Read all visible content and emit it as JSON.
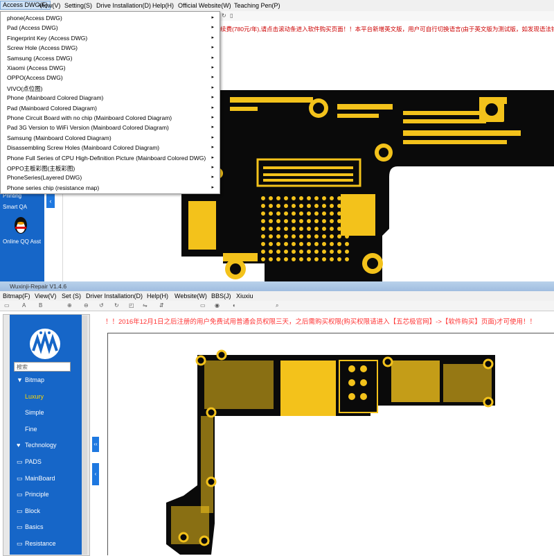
{
  "top_window": {
    "menu": [
      "Access DWG(F)",
      "View(V)",
      "Setting(S)",
      "Drive Installation(D)",
      "Help(H)",
      "Official Website(W)",
      "Teaching Pen(P)"
    ],
    "notice": "续费(780元/年),请点击滚动条进入软件购买页面！！本平台新增英文版，用户可自行切换语言(由于英文版为测试版，如发现语法错误",
    "dropdown_items": [
      "phone(Access DWG)",
      "Pad (Access DWG)",
      "Fingerprint Key (Access DWG)",
      "Screw Hole (Access DWG)",
      "Samsung (Access DWG)",
      "Xiaomi (Access DWG)",
      "OPPO(Access DWG)",
      "VIVO(点位图)",
      "Phone (Mainboard Colored Diagram)",
      "Pad (Mainboard Colored Diagram)",
      "Phone Circuit Board with no chip (Mainboard Colored Diagram)",
      "Pad 3G Version to WiFi Version (Mainboard Colored Diagram)",
      "Samsung (Mainboard Colored Diagram)",
      "Disassembling Screw Holes (Mainboard Colored Diagram)",
      "Phone Full Series of CPU High-Definition Picture (Mainboard Colored DWG)",
      "OPPO主板彩图(主板彩图)",
      "PhoneSeries(Layered DWG)",
      "Phone series chip (resistance map)"
    ],
    "sidebar": {
      "printing": "Printing",
      "smart_qa": "Smart QA",
      "qq": "Online QQ Asst"
    },
    "collapse_arrow": "‹"
  },
  "bottom_window": {
    "title": "Wuxinji-Repair V1.4.6",
    "menu": [
      "Bitmap(F)",
      "View(V)",
      "Set (S)",
      "Driver Installation(D)",
      "Help(H)",
      "Website(W)",
      "BBS(J)",
      "Xiuxiu"
    ],
    "search_placeholder": "搜索",
    "nav": [
      {
        "label": "Bitmap",
        "icon": "▼"
      },
      {
        "label": "Luxury",
        "icon": ""
      },
      {
        "label": "Simple",
        "icon": ""
      },
      {
        "label": "Fine",
        "icon": ""
      },
      {
        "label": "Technology",
        "icon": "♥"
      },
      {
        "label": "PADS",
        "icon": "▭"
      },
      {
        "label": "MainBoard",
        "icon": "▭"
      },
      {
        "label": "Principle",
        "icon": "▭"
      },
      {
        "label": "Block",
        "icon": "▭"
      },
      {
        "label": "Basics",
        "icon": "▭"
      },
      {
        "label": "Resistance",
        "icon": "▭"
      }
    ],
    "notice": "！！2016年12月1日之后注册的用户免费试用普通会员权限三天，之后需购买权限(购买权限请进入【五芯极官网】->【软件购买】页面)才可使用！！",
    "collapse1": "‹‹",
    "collapse2": "‹"
  },
  "colors": {
    "sidebar_blue": "#1666c8",
    "board_black": "#0a0a0a",
    "pad_gold": "#f3c21b",
    "notice_red": "#e03030"
  }
}
